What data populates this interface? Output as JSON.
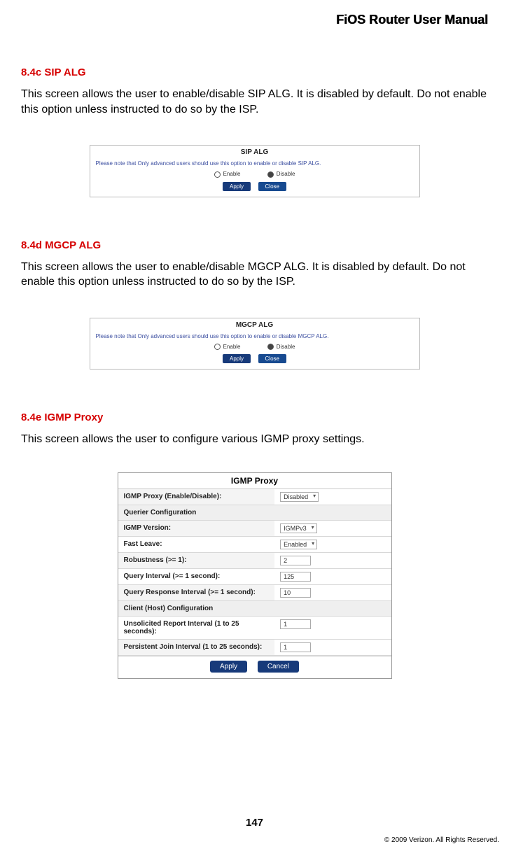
{
  "header": {
    "title": "FiOS Router User Manual"
  },
  "sections": {
    "sip": {
      "heading": "8.4c  SIP ALG",
      "body": "This screen allows the user to enable/disable SIP ALG. It is disabled by default. Do not enable this option unless instructed to do so by the ISP.",
      "panel_title": "SIP ALG",
      "note": "Please note that Only advanced users should use this option to enable or disable SIP ALG.",
      "enable_label": "Enable",
      "disable_label": "Disable",
      "apply": "Apply",
      "close": "Close"
    },
    "mgcp": {
      "heading": "8.4d  MGCP ALG",
      "body": "This screen allows the user to enable/disable MGCP ALG. It is disabled by default. Do not enable this option unless instructed to do so by the ISP.",
      "panel_title": "MGCP ALG",
      "note": "Please note that Only advanced users should use this option to enable or disable MGCP ALG.",
      "enable_label": "Enable",
      "disable_label": "Disable",
      "apply": "Apply",
      "close": "Close"
    },
    "igmp": {
      "heading": "8.4e  IGMP Proxy",
      "body": "This screen allows the user to configure various IGMP proxy settings.",
      "panel_title": "IGMP Proxy",
      "rows": {
        "proxy_enable": {
          "label": "IGMP Proxy (Enable/Disable):",
          "value": "Disabled"
        },
        "querier_cfg": {
          "label": "Querier Configuration"
        },
        "version": {
          "label": "IGMP Version:",
          "value": "IGMPv3"
        },
        "fast_leave": {
          "label": "Fast Leave:",
          "value": "Enabled"
        },
        "robustness": {
          "label": "Robustness (>= 1):",
          "value": "2"
        },
        "query_interval": {
          "label": "Query Interval (>= 1 second):",
          "value": "125"
        },
        "query_response": {
          "label": "Query Response Interval (>= 1 second):",
          "value": "10"
        },
        "client_cfg": {
          "label": "Client (Host) Configuration"
        },
        "unsolicited": {
          "label": "Unsolicited Report Interval (1 to 25 seconds):",
          "value": "1"
        },
        "persistent": {
          "label": "Persistent Join Interval (1 to 25 seconds):",
          "value": "1"
        }
      },
      "apply": "Apply",
      "cancel": "Cancel"
    }
  },
  "footer": {
    "page_number": "147",
    "copyright": "© 2009 Verizon. All Rights Reserved."
  }
}
